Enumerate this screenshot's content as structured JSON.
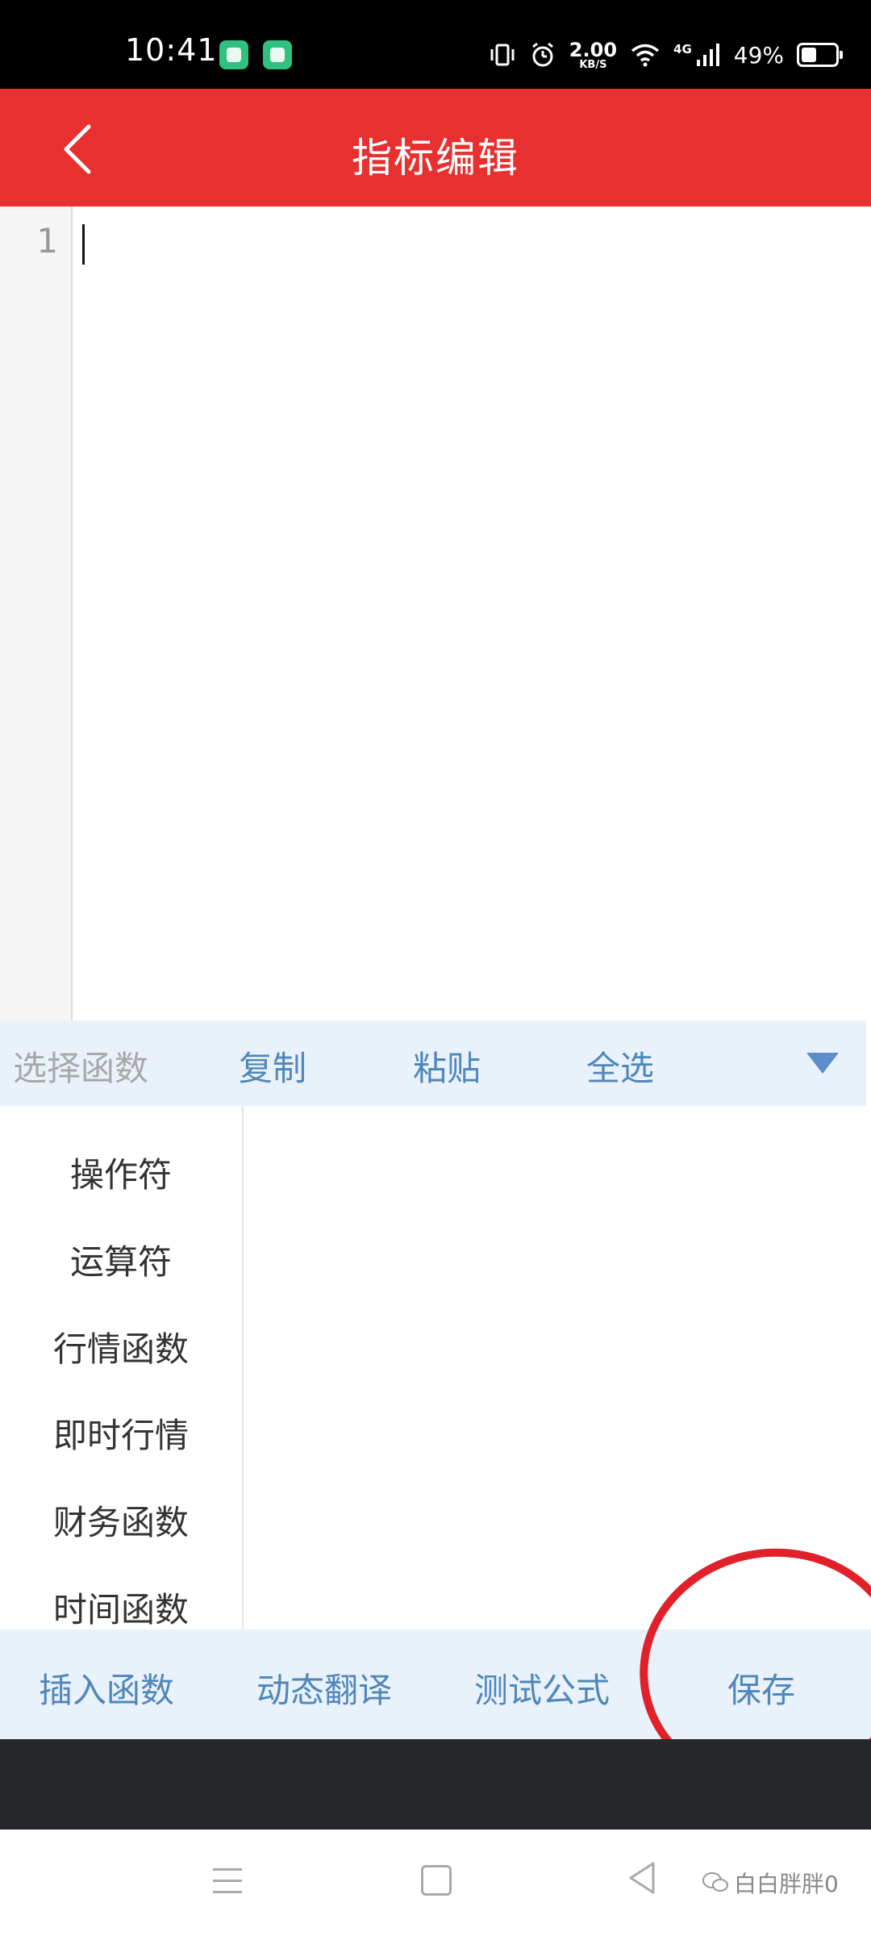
{
  "status_bar": {
    "time": "10:41",
    "speed_value": "2.00",
    "speed_unit": "KB/S",
    "network": "4G",
    "battery": "49%"
  },
  "header": {
    "title": "指标编辑",
    "back_icon": "chevron-left-icon"
  },
  "editor": {
    "line_numbers": [
      "1"
    ],
    "content": ""
  },
  "toolbar": {
    "select_function": "选择函数",
    "copy": "复制",
    "paste": "粘贴",
    "select_all": "全选",
    "collapse_icon": "triangle-down-icon"
  },
  "categories": [
    {
      "label": "操作符"
    },
    {
      "label": "运算符"
    },
    {
      "label": "行情函数"
    },
    {
      "label": "即时行情"
    },
    {
      "label": "财务函数"
    },
    {
      "label": "时间函数"
    }
  ],
  "actions": {
    "insert_function": "插入函数",
    "dynamic_translate": "动态翻译",
    "test_formula": "测试公式",
    "save": "保存"
  },
  "colors": {
    "header": "#e83030",
    "action_text": "#4f87ba",
    "toolbar_bg": "#e9f1fb",
    "annotation": "#e0212a"
  },
  "watermark": {
    "text": "白白胖胖0"
  }
}
